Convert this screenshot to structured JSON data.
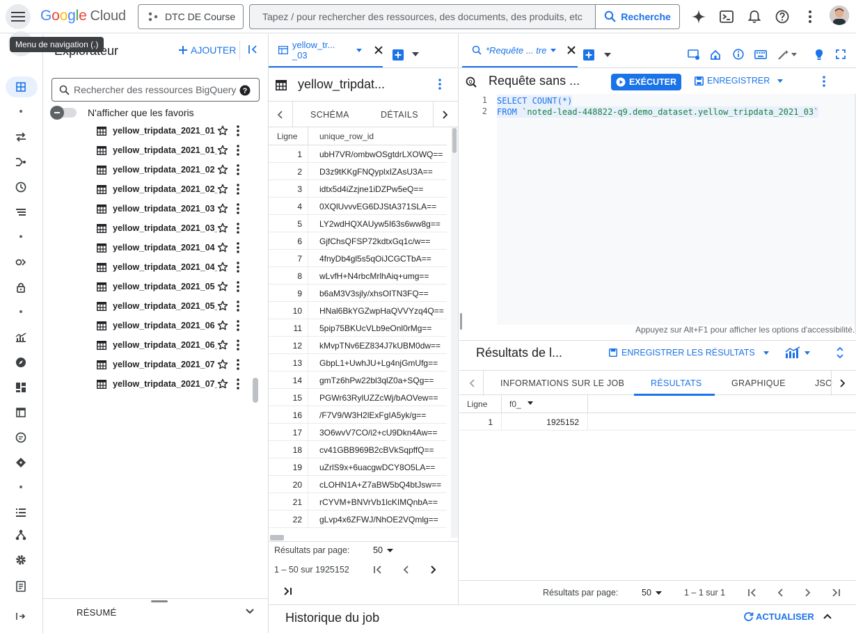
{
  "header": {
    "brand": "Google",
    "brand_product": "Cloud",
    "project": "DTC DE Course",
    "search_placeholder": "Tapez / pour rechercher des ressources, des documents, des produits, etc",
    "search_button": "Recherche",
    "tooltip": "Menu de navigation (.)"
  },
  "explorer": {
    "title": "Explorateur",
    "add_label": "AJOUTER",
    "search_placeholder": "Rechercher des ressources BigQuery",
    "favorites_toggle": "N'afficher que les favoris",
    "tables": [
      "yellow_tripdata_2021_01",
      "yellow_tripdata_2021_01_...",
      "yellow_tripdata_2021_02",
      "yellow_tripdata_2021_02_...",
      "yellow_tripdata_2021_03",
      "yellow_tripdata_2021_03_...",
      "yellow_tripdata_2021_04",
      "yellow_tripdata_2021_04_...",
      "yellow_tripdata_2021_05",
      "yellow_tripdata_2021_05_...",
      "yellow_tripdata_2021_06",
      "yellow_tripdata_2021_06_...",
      "yellow_tripdata_2021_07",
      "yellow_tripdata_2021_07_..."
    ],
    "summary_label": "RÉSUMÉ"
  },
  "table_panel": {
    "tab_label": "yellow_tr... _03",
    "title": "yellow_tripdat...",
    "subtabs": [
      "SCHÉMA",
      "DÉTAILS"
    ],
    "columns": [
      "Ligne",
      "unique_row_id"
    ],
    "rows": [
      [
        "1",
        "ubH7VR/ombwOSgtdrLXOWQ=="
      ],
      [
        "2",
        "D3z9tKKgFNQyplxIZAsU3A=="
      ],
      [
        "3",
        "idtx5d4iZzjne1iDZPw5eQ=="
      ],
      [
        "4",
        "0XQlUvvvEG6DJStA371SLA=="
      ],
      [
        "5",
        "LY2wdHQXAUyw5I63s6ww8g=="
      ],
      [
        "6",
        "GjfChsQFSP72kdtxGq1c/w=="
      ],
      [
        "7",
        "4fnyDb4gl5s5qOiJCGCTbA=="
      ],
      [
        "8",
        "wLvfH+N4rbcMrlhAiq+umg=="
      ],
      [
        "9",
        "b6aM3V3sjly/xhsOITN3FQ=="
      ],
      [
        "10",
        "HNal6BkYGZwpHaQVVYzq4Q=="
      ],
      [
        "11",
        "5pip75BKUcVLb9eOnl0rMg=="
      ],
      [
        "12",
        "kMvpTNv6EZ834J7kUBM0dw=="
      ],
      [
        "13",
        "GbpL1+UwhJU+Lg4njGmUfg=="
      ],
      [
        "14",
        "gmTz6hPw22bl3qlZ0a+SQg=="
      ],
      [
        "15",
        "PGWr63RylUZZcWj/bAOVew=="
      ],
      [
        "16",
        "/F7V9/W3H2lExFgIA5yk/g=="
      ],
      [
        "17",
        "3O6wvV7CO/i2+cU9Dkn4Aw=="
      ],
      [
        "18",
        "cv41GBB969B2cBVkSqpffQ=="
      ],
      [
        "19",
        "uZrlS9x+6uacgwDCY8O5LA=="
      ],
      [
        "20",
        "cLOHN1A+Z7aBW5bQ4btJsw=="
      ],
      [
        "21",
        "rCYVM+BNVrVb1lcKIMQnbA=="
      ],
      [
        "22",
        "gLvp4x6ZFWJ/NhOE2VQmlg=="
      ]
    ],
    "per_page_label": "Résultats par page:",
    "per_page_value": "50",
    "range": "1 – 50 sur 1925152"
  },
  "query_panel": {
    "tab_label": "*Requête ... tre",
    "title": "Requête sans ...",
    "run_label": "EXÉCUTER",
    "save_label": "ENREGISTRER",
    "code_lines": [
      {
        "n": "1",
        "kw": "SELECT COUNT(*)",
        "rest": ""
      },
      {
        "n": "2",
        "kw": "FROM ",
        "rest": "`noted-lead-448822-q9.demo_dataset.yellow_tripdata_2021_03`"
      }
    ],
    "hint": "Appuyez sur Alt+F1 pour afficher les options d'accessibilité.",
    "results_title": "Résultats de l...",
    "save_results_label": "ENREGISTRER LES RÉSULTATS",
    "result_tabs": [
      "INFORMATIONS SUR LE JOB",
      "RÉSULTATS",
      "GRAPHIQUE",
      "JSO"
    ],
    "result_columns": [
      "Ligne",
      "f0_"
    ],
    "result_row": [
      "1",
      "1925152"
    ],
    "per_page_label": "Résultats par page:",
    "per_page_value": "50",
    "range": "1 – 1 sur 1"
  },
  "job_history": {
    "title": "Historique du job",
    "refresh_label": "ACTUALISER"
  },
  "colors": {
    "accent": "#1a73e8",
    "text": "#202124",
    "border": "#dadce0"
  }
}
